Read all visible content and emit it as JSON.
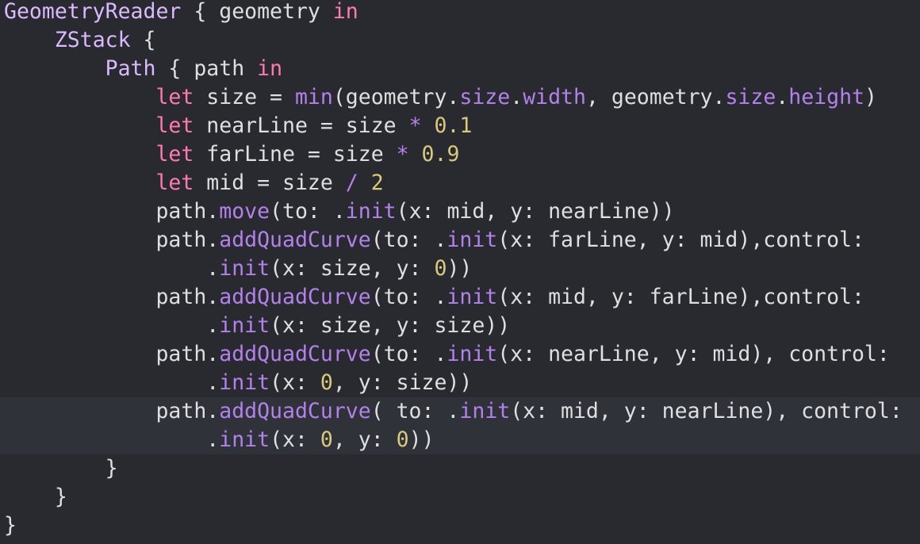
{
  "colors": {
    "background": "#292a30",
    "current_line": "#2f3239",
    "plain": "#dfdfe0",
    "keyword": "#ff7ab2",
    "type": "#dabaff",
    "method": "#b281eb",
    "number": "#d9c97c"
  },
  "code": {
    "current_line_index": 14,
    "lines": [
      {
        "tokens": [
          {
            "t": "GeometryReader",
            "k": "type"
          },
          {
            "t": " { geometry ",
            "k": "plain"
          },
          {
            "t": "in",
            "k": "keyword"
          }
        ]
      },
      {
        "tokens": [
          {
            "t": "    ",
            "k": "plain"
          },
          {
            "t": "ZStack",
            "k": "type"
          },
          {
            "t": " {",
            "k": "plain"
          }
        ]
      },
      {
        "tokens": [
          {
            "t": "        ",
            "k": "plain"
          },
          {
            "t": "Path",
            "k": "type"
          },
          {
            "t": " { path ",
            "k": "plain"
          },
          {
            "t": "in",
            "k": "keyword"
          }
        ]
      },
      {
        "tokens": [
          {
            "t": "            ",
            "k": "plain"
          },
          {
            "t": "let",
            "k": "keyword"
          },
          {
            "t": " size = ",
            "k": "plain"
          },
          {
            "t": "min",
            "k": "method"
          },
          {
            "t": "(geometry.",
            "k": "plain"
          },
          {
            "t": "size",
            "k": "method"
          },
          {
            "t": ".",
            "k": "plain"
          },
          {
            "t": "width",
            "k": "method"
          },
          {
            "t": ", geometry.",
            "k": "plain"
          },
          {
            "t": "size",
            "k": "method"
          },
          {
            "t": ".",
            "k": "plain"
          },
          {
            "t": "height",
            "k": "method"
          },
          {
            "t": ")",
            "k": "plain"
          }
        ]
      },
      {
        "tokens": [
          {
            "t": "            ",
            "k": "plain"
          },
          {
            "t": "let",
            "k": "keyword"
          },
          {
            "t": " nearLine = size ",
            "k": "plain"
          },
          {
            "t": "*",
            "k": "method"
          },
          {
            "t": " ",
            "k": "plain"
          },
          {
            "t": "0.1",
            "k": "number"
          }
        ]
      },
      {
        "tokens": [
          {
            "t": "            ",
            "k": "plain"
          },
          {
            "t": "let",
            "k": "keyword"
          },
          {
            "t": " farLine = size ",
            "k": "plain"
          },
          {
            "t": "*",
            "k": "method"
          },
          {
            "t": " ",
            "k": "plain"
          },
          {
            "t": "0.9",
            "k": "number"
          }
        ]
      },
      {
        "tokens": [
          {
            "t": "            ",
            "k": "plain"
          },
          {
            "t": "let",
            "k": "keyword"
          },
          {
            "t": " mid = size ",
            "k": "plain"
          },
          {
            "t": "/",
            "k": "method"
          },
          {
            "t": " ",
            "k": "plain"
          },
          {
            "t": "2",
            "k": "number"
          }
        ]
      },
      {
        "tokens": [
          {
            "t": "            path.",
            "k": "plain"
          },
          {
            "t": "move",
            "k": "method"
          },
          {
            "t": "(to: .",
            "k": "plain"
          },
          {
            "t": "init",
            "k": "method"
          },
          {
            "t": "(x: mid, y: nearLine))",
            "k": "plain"
          }
        ]
      },
      {
        "tokens": [
          {
            "t": "            path.",
            "k": "plain"
          },
          {
            "t": "addQuadCurve",
            "k": "method"
          },
          {
            "t": "(to: .",
            "k": "plain"
          },
          {
            "t": "init",
            "k": "method"
          },
          {
            "t": "(x: farLine, y: mid),control:",
            "k": "plain"
          }
        ]
      },
      {
        "tokens": [
          {
            "t": "                .",
            "k": "plain"
          },
          {
            "t": "init",
            "k": "method"
          },
          {
            "t": "(x: size, y: ",
            "k": "plain"
          },
          {
            "t": "0",
            "k": "number"
          },
          {
            "t": "))",
            "k": "plain"
          }
        ]
      },
      {
        "tokens": [
          {
            "t": "            path.",
            "k": "plain"
          },
          {
            "t": "addQuadCurve",
            "k": "method"
          },
          {
            "t": "(to: .",
            "k": "plain"
          },
          {
            "t": "init",
            "k": "method"
          },
          {
            "t": "(x: mid, y: farLine),control:",
            "k": "plain"
          }
        ]
      },
      {
        "tokens": [
          {
            "t": "                .",
            "k": "plain"
          },
          {
            "t": "init",
            "k": "method"
          },
          {
            "t": "(x: size, y: size))",
            "k": "plain"
          }
        ]
      },
      {
        "tokens": [
          {
            "t": "            path.",
            "k": "plain"
          },
          {
            "t": "addQuadCurve",
            "k": "method"
          },
          {
            "t": "(to: .",
            "k": "plain"
          },
          {
            "t": "init",
            "k": "method"
          },
          {
            "t": "(x: nearLine, y: mid), control:",
            "k": "plain"
          }
        ]
      },
      {
        "tokens": [
          {
            "t": "                .",
            "k": "plain"
          },
          {
            "t": "init",
            "k": "method"
          },
          {
            "t": "(x: ",
            "k": "plain"
          },
          {
            "t": "0",
            "k": "number"
          },
          {
            "t": ", y: size))",
            "k": "plain"
          }
        ]
      },
      {
        "tokens": [
          {
            "t": "            path.",
            "k": "plain"
          },
          {
            "t": "addQuadCurve",
            "k": "method"
          },
          {
            "t": "( to: .",
            "k": "plain"
          },
          {
            "t": "init",
            "k": "method"
          },
          {
            "t": "(x: mid, y: nearLine), control:",
            "k": "plain"
          }
        ]
      },
      {
        "tokens": [
          {
            "t": "                .",
            "k": "plain"
          },
          {
            "t": "init",
            "k": "method"
          },
          {
            "t": "(x: ",
            "k": "plain"
          },
          {
            "t": "0",
            "k": "number"
          },
          {
            "t": ", y: ",
            "k": "plain"
          },
          {
            "t": "0",
            "k": "number"
          },
          {
            "t": "))",
            "k": "plain"
          }
        ]
      },
      {
        "tokens": [
          {
            "t": "        }",
            "k": "plain"
          }
        ]
      },
      {
        "tokens": [
          {
            "t": "    }",
            "k": "plain"
          }
        ]
      },
      {
        "tokens": [
          {
            "t": "}",
            "k": "plain"
          }
        ]
      }
    ]
  }
}
